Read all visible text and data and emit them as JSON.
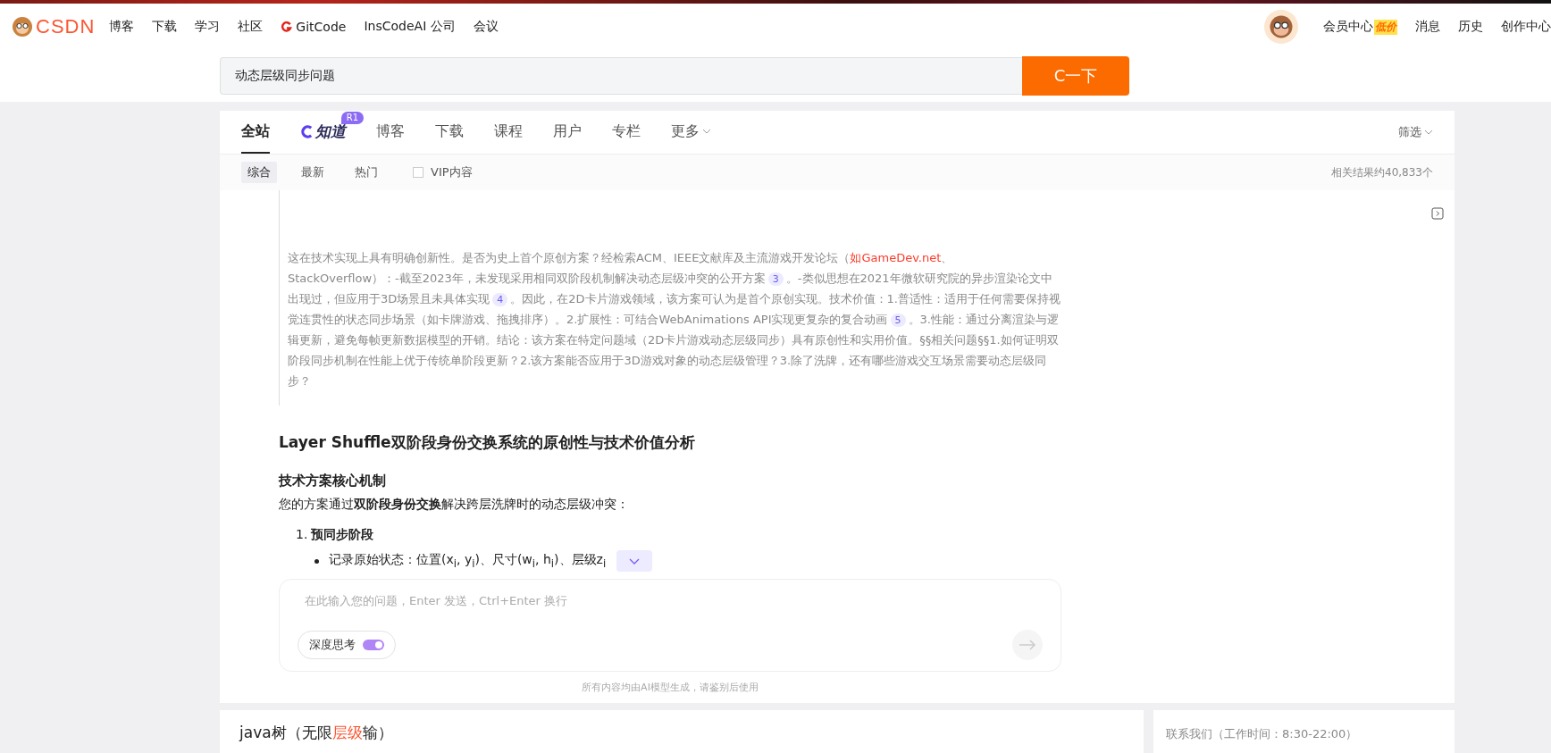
{
  "top_nav": {
    "logo": "CSDN",
    "items": [
      {
        "label": "博客",
        "kind": "text"
      },
      {
        "label": "下载",
        "kind": "text"
      },
      {
        "label": "学习",
        "kind": "text"
      },
      {
        "label": "社区",
        "kind": "text"
      },
      {
        "label": "GitCode",
        "kind": "gitcode"
      },
      {
        "label": "InsCodeAI 公司",
        "kind": "text"
      },
      {
        "label": "会议",
        "kind": "text"
      }
    ],
    "right_items": [
      {
        "label": "会员中心",
        "badge": "低价"
      },
      {
        "label": "消息"
      },
      {
        "label": "历史"
      },
      {
        "label": "创作中心"
      }
    ]
  },
  "search": {
    "value": "动态层级同步问题",
    "button": "C一下"
  },
  "tabs": [
    {
      "label": "全站",
      "kind": "text",
      "selected": true
    },
    {
      "label": "知道",
      "kind": "logo",
      "badge": "R1",
      "selected": false
    },
    {
      "label": "博客",
      "kind": "text",
      "selected": false
    },
    {
      "label": "下载",
      "kind": "text",
      "selected": false
    },
    {
      "label": "课程",
      "kind": "text",
      "selected": false
    },
    {
      "label": "用户",
      "kind": "text",
      "selected": false
    },
    {
      "label": "专栏",
      "kind": "text",
      "selected": false
    },
    {
      "label": "更多",
      "kind": "dropdown",
      "selected": false
    }
  ],
  "filter": "筛选",
  "sort_options": [
    {
      "label": "综合",
      "selected": true
    },
    {
      "label": "最新",
      "selected": false
    },
    {
      "label": "热门",
      "selected": false
    }
  ],
  "vip_filter": {
    "label": "VIP内容",
    "checked": false
  },
  "result_count": "相关结果约40,833个",
  "answer": {
    "quote": [
      {
        "kind": "text",
        "text": "这在技术实现上具有明确创新性。是否为史上首个原创方案？经检索ACM、IEEE文献库及主流游戏开发论坛（"
      },
      {
        "kind": "link",
        "text": "如GameDev.net"
      },
      {
        "kind": "text",
        "text": "、StackOverflow）：-截至2023年，未发现采用相同双阶段机制解决动态层级冲突的公开方案"
      },
      {
        "kind": "cite",
        "text": "3"
      },
      {
        "kind": "text",
        "text": "。-类似思想在2021年微软研究院的异步渲染论文中出现过，但应用于3D场景且未具体实现"
      },
      {
        "kind": "cite",
        "text": "4"
      },
      {
        "kind": "text",
        "text": "。因此，在2D卡片游戏领域，该方案可认为是首个原创实现。技术价值：1.普适性：适用于任何需要保持视觉连贯性的状态同步场景（如卡牌游戏、拖拽排序）。2.扩展性：可结合WebAnimations API实现更复杂的复合动画"
      },
      {
        "kind": "cite",
        "text": "5"
      },
      {
        "kind": "text",
        "text": "。3.性能：通过分离渲染与逻辑更新，避免每帧更新数据模型的开销。结论：该方案在特定问题域（2D卡片游戏动态层级同步）具有原创性和实用价值。§§相关问题§§1.如何证明双阶段同步机制在性能上优于传统单阶段更新？2.该方案能否应用于3D游戏对象的动态层级管理？3.除了洗牌，还有哪些游戏交互场景需要动态层级同步？"
      }
    ],
    "heading": "Layer Shuffle双阶段身份交换系统的原创性与技术价值分析",
    "subheading": "技术方案核心机制",
    "intro": "您的方案通过**双阶段身份交换**解决跨层洗牌时的动态层级冲突：",
    "steps": [
      {
        "number": "1.",
        "title": "预同步阶段",
        "bullets": [
          "记录原始状态：位置(x$_{i}$, y$_{i}$)、尺寸(w$_{i}$, h$_{i}$)、层级z$_{i}$"
        ]
      }
    ]
  },
  "chat_input": {
    "placeholder": "在此输入您的问题，Enter 发送，Ctrl+Enter 换行",
    "deep_think": {
      "label": "深度思考",
      "on": true
    }
  },
  "disclaimer": "所有内容均由AI模型生成，请鉴别后使用",
  "result": {
    "title_parts": [
      {
        "text": "java树（无限",
        "highlight": false
      },
      {
        "text": "层级",
        "highlight": true
      },
      {
        "text": "输）",
        "highlight": false
      }
    ]
  },
  "contact": {
    "title": "联系我们（工作时间：8:30-22:00）"
  }
}
